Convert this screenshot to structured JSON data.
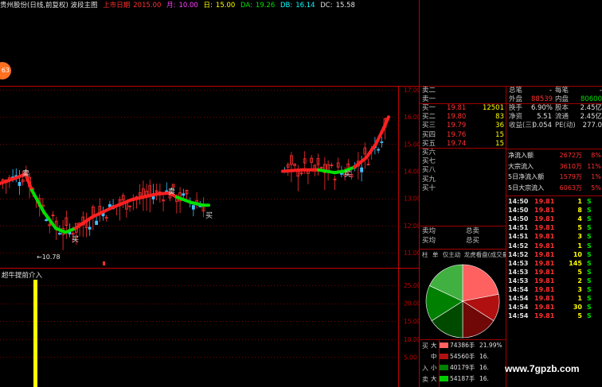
{
  "header": {
    "stock_title": "贵州股份(日线,前复权) 波段主图",
    "limit_label": "上市日期",
    "limit_value": "2015.00",
    "month_label": "月:",
    "month_value": "10.00",
    "day_label": "日:",
    "day_value": "15.00",
    "da_label": "DA:",
    "da_value": "19.26",
    "db_label": "DB:",
    "db_value": "16.14",
    "dc_label": "DC:",
    "dc_value": "15.58"
  },
  "badge": {
    "text": "63"
  },
  "main_chart": {
    "price_axis": [
      "17.00",
      "16.00",
      "15.00",
      "14.00",
      "13.00",
      "12.00",
      "11.00"
    ],
    "low_marker": "10.78",
    "markers": {
      "sell": "卖",
      "buy": "买"
    }
  },
  "indicator": {
    "title": "超牛提前介入",
    "axis": [
      "25.00",
      "20.00",
      "15.00",
      "10.00",
      "5.00"
    ]
  },
  "order_book": {
    "top": [
      {
        "label": "卖二",
        "price": "",
        "vol": ""
      },
      {
        "label": "卖一",
        "price": "",
        "vol": ""
      }
    ],
    "bids": [
      {
        "label": "买一",
        "price": "19.81",
        "vol": "12501"
      },
      {
        "label": "买二",
        "price": "19.80",
        "vol": "83"
      },
      {
        "label": "买三",
        "price": "19.79",
        "vol": "36"
      },
      {
        "label": "买四",
        "price": "19.76",
        "vol": "15"
      },
      {
        "label": "买五",
        "price": "19.74",
        "vol": "15"
      },
      {
        "label": "买六",
        "price": "",
        "vol": ""
      },
      {
        "label": "买七",
        "price": "",
        "vol": ""
      },
      {
        "label": "买八",
        "price": "",
        "vol": ""
      },
      {
        "label": "买九",
        "price": "",
        "vol": ""
      },
      {
        "label": "买十",
        "price": "",
        "vol": ""
      }
    ],
    "sell_avg_label": "卖均",
    "sell_total_label": "总卖",
    "buy_avg_label": "买均",
    "buy_total_label": "总买"
  },
  "stats": {
    "row1": {
      "a": "总笔",
      "b": "-",
      "c": "每笔",
      "d": "-"
    },
    "row2": {
      "a": "外盘",
      "b": "88539",
      "c": "内盘",
      "d": "80600"
    },
    "row3": {
      "a": "换手",
      "b": "6.90%",
      "c": "股本",
      "d": "2.45亿"
    },
    "row4": {
      "a": "净资",
      "b": "5.51",
      "c": "流通",
      "d": "2.45亿"
    },
    "row5": {
      "a": "收益(三)",
      "b": "0.054",
      "c": "PE(动)",
      "d": "277.0"
    }
  },
  "flows": [
    {
      "label": "净流入额",
      "value": "2672万",
      "pct": "8%"
    },
    {
      "label": "大宗流入",
      "value": "3610万",
      "pct": "11%"
    },
    {
      "label": "5日净流入额",
      "value": "1579万",
      "pct": "1%"
    },
    {
      "label": "5日大宗流入",
      "value": "6063万",
      "pct": "5%"
    }
  ],
  "ticks": [
    {
      "time": "14:50",
      "price": "19.81",
      "vol": "1",
      "side": "S"
    },
    {
      "time": "14:50",
      "price": "19.81",
      "vol": "8",
      "side": "S"
    },
    {
      "time": "14:50",
      "price": "19.81",
      "vol": "4",
      "side": "S"
    },
    {
      "time": "14:51",
      "price": "19.81",
      "vol": "5",
      "side": "S"
    },
    {
      "time": "14:51",
      "price": "19.81",
      "vol": "3",
      "side": "S"
    },
    {
      "time": "14:52",
      "price": "19.81",
      "vol": "1",
      "side": "S"
    },
    {
      "time": "14:52",
      "price": "19.81",
      "vol": "10",
      "side": "S"
    },
    {
      "time": "14:53",
      "price": "19.81",
      "vol": "145",
      "side": "S"
    },
    {
      "time": "14:53",
      "price": "19.81",
      "vol": "5",
      "side": "S"
    },
    {
      "time": "14:53",
      "price": "19.81",
      "vol": "2",
      "side": "S"
    },
    {
      "time": "14:54",
      "price": "19.81",
      "vol": "3",
      "side": "S"
    },
    {
      "time": "14:54",
      "price": "19.81",
      "vol": "1",
      "side": "S"
    },
    {
      "time": "14:54",
      "price": "19.81",
      "vol": "30",
      "side": "S"
    },
    {
      "time": "14:54",
      "price": "19.81",
      "vol": "5",
      "side": "S"
    }
  ],
  "dragon_tabs": {
    "tab1": "柱",
    "tab2": "单",
    "tab3": "仅主动",
    "tab4": "龙虎看盘(成交量/股)"
  },
  "capital": {
    "side_buy": "买",
    "side_in": "入",
    "side_sell": "卖",
    "rows": [
      {
        "size": "大",
        "value": "74386手",
        "pct": "21.99%",
        "color": "#ff6060"
      },
      {
        "size": "中",
        "value": "54560手",
        "pct": "16.",
        "color": "#b01010"
      },
      {
        "size": "小",
        "value": "40179手",
        "pct": "16.",
        "color": "#008000"
      },
      {
        "size": "大",
        "value": "54187手",
        "pct": "16.",
        "color": "#00cc00"
      }
    ]
  },
  "pie": [
    {
      "label": "big_buy",
      "value": 21.99,
      "color": "#ff6060"
    },
    {
      "label": "mid_buy",
      "value": 12.0,
      "color": "#b01010"
    },
    {
      "label": "small_buy",
      "value": 16.0,
      "color": "#700808"
    },
    {
      "label": "big_sell",
      "value": 16.0,
      "color": "#004a00"
    },
    {
      "label": "mid_sell",
      "value": 16.0,
      "color": "#008000"
    },
    {
      "label": "small_sell",
      "value": 18.01,
      "color": "#40b040"
    }
  ],
  "watermark": "www.7gpzb.com",
  "colors": {
    "up": "#ff3030",
    "down": "#00e000",
    "grid": "#800000",
    "bg": "#000000"
  }
}
